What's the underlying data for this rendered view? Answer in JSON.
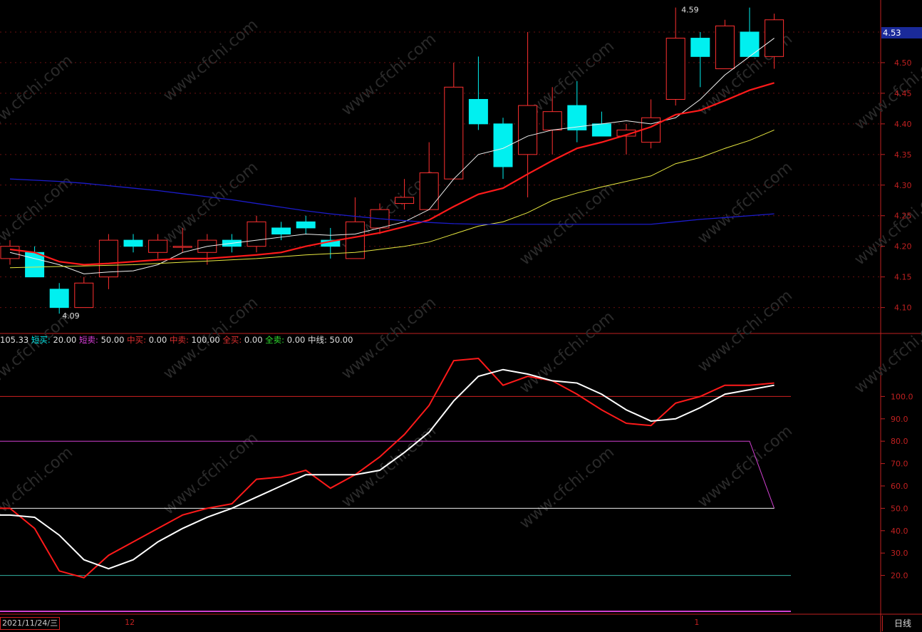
{
  "price_tag": "4.53",
  "period_button": "日线",
  "date_label": "2021/11/24/三",
  "x_labels": [
    {
      "text": "12",
      "index": 4.6
    },
    {
      "text": "1",
      "index": 27.7
    }
  ],
  "indicator_prefix": "105.33",
  "indicator_items": [
    {
      "label": "短买:",
      "value": "20.00",
      "color": "#00e5e5"
    },
    {
      "label": "短卖:",
      "value": "50.00",
      "color": "#e040e0"
    },
    {
      "label": "中买:",
      "value": "0.00",
      "color": "#e03030"
    },
    {
      "label": "中卖:",
      "value": "100.00",
      "color": "#e03030"
    },
    {
      "label": "全买:",
      "value": "0.00",
      "color": "#e03030"
    },
    {
      "label": "全卖:",
      "value": "0.00",
      "color": "#30e030"
    },
    {
      "label": "中线:",
      "value": "50.00",
      "color": "#e0e0e0"
    }
  ],
  "watermark": "www.cfchi.com",
  "chart_data": [
    {
      "type": "candlestick",
      "ylim": [
        4.06,
        4.6
      ],
      "y_ticks": [
        4.1,
        4.15,
        4.2,
        4.25,
        4.3,
        4.35,
        4.4,
        4.45,
        4.5,
        4.55
      ],
      "annotations": [
        {
          "text": "4.09",
          "index": 2
        },
        {
          "text": "4.59",
          "index": 27
        }
      ],
      "candles": [
        {
          "o": 4.18,
          "h": 4.21,
          "l": 4.17,
          "c": 4.2
        },
        {
          "o": 4.19,
          "h": 4.2,
          "l": 4.15,
          "c": 4.15
        },
        {
          "o": 4.13,
          "h": 4.14,
          "l": 4.09,
          "c": 4.1
        },
        {
          "o": 4.1,
          "h": 4.15,
          "l": 4.1,
          "c": 4.14
        },
        {
          "o": 4.15,
          "h": 4.22,
          "l": 4.13,
          "c": 4.21
        },
        {
          "o": 4.21,
          "h": 4.22,
          "l": 4.19,
          "c": 4.2
        },
        {
          "o": 4.19,
          "h": 4.22,
          "l": 4.18,
          "c": 4.21
        },
        {
          "o": 4.2,
          "h": 4.23,
          "l": 4.19,
          "c": 4.2
        },
        {
          "o": 4.19,
          "h": 4.22,
          "l": 4.17,
          "c": 4.21
        },
        {
          "o": 4.21,
          "h": 4.22,
          "l": 4.19,
          "c": 4.2
        },
        {
          "o": 4.2,
          "h": 4.25,
          "l": 4.19,
          "c": 4.24
        },
        {
          "o": 4.23,
          "h": 4.24,
          "l": 4.21,
          "c": 4.22
        },
        {
          "o": 4.24,
          "h": 4.25,
          "l": 4.22,
          "c": 4.23
        },
        {
          "o": 4.21,
          "h": 4.23,
          "l": 4.18,
          "c": 4.2
        },
        {
          "o": 4.18,
          "h": 4.28,
          "l": 4.18,
          "c": 4.24
        },
        {
          "o": 4.23,
          "h": 4.27,
          "l": 4.22,
          "c": 4.26
        },
        {
          "o": 4.27,
          "h": 4.31,
          "l": 4.26,
          "c": 4.28
        },
        {
          "o": 4.26,
          "h": 4.37,
          "l": 4.26,
          "c": 4.32
        },
        {
          "o": 4.31,
          "h": 4.5,
          "l": 4.31,
          "c": 4.46
        },
        {
          "o": 4.44,
          "h": 4.51,
          "l": 4.39,
          "c": 4.4
        },
        {
          "o": 4.4,
          "h": 4.41,
          "l": 4.31,
          "c": 4.33
        },
        {
          "o": 4.35,
          "h": 4.55,
          "l": 4.28,
          "c": 4.43
        },
        {
          "o": 4.39,
          "h": 4.46,
          "l": 4.35,
          "c": 4.42
        },
        {
          "o": 4.43,
          "h": 4.47,
          "l": 4.37,
          "c": 4.39
        },
        {
          "o": 4.4,
          "h": 4.42,
          "l": 4.38,
          "c": 4.38
        },
        {
          "o": 4.38,
          "h": 4.4,
          "l": 4.35,
          "c": 4.39
        },
        {
          "o": 4.37,
          "h": 4.44,
          "l": 4.36,
          "c": 4.41
        },
        {
          "o": 4.44,
          "h": 4.59,
          "l": 4.43,
          "c": 4.54
        },
        {
          "o": 4.54,
          "h": 4.55,
          "l": 4.46,
          "c": 4.51
        },
        {
          "o": 4.49,
          "h": 4.57,
          "l": 4.49,
          "c": 4.56
        },
        {
          "o": 4.55,
          "h": 4.59,
          "l": 4.51,
          "c": 4.51
        },
        {
          "o": 4.51,
          "h": 4.58,
          "l": 4.49,
          "c": 4.57
        }
      ],
      "series": [
        {
          "color": "#f0f0f0",
          "width": 1,
          "values": [
            4.19,
            4.18,
            4.17,
            4.155,
            4.158,
            4.16,
            4.17,
            4.19,
            4.2,
            4.205,
            4.21,
            4.215,
            4.22,
            4.218,
            4.22,
            4.23,
            4.24,
            4.26,
            4.31,
            4.35,
            4.36,
            4.38,
            4.39,
            4.395,
            4.4,
            4.405,
            4.4,
            4.41,
            4.44,
            4.48,
            4.51,
            4.54
          ]
        },
        {
          "color": "#ff1a1a",
          "width": 2.2,
          "values": [
            4.195,
            4.19,
            4.175,
            4.17,
            4.172,
            4.175,
            4.178,
            4.18,
            4.18,
            4.183,
            4.186,
            4.19,
            4.2,
            4.208,
            4.215,
            4.222,
            4.232,
            4.243,
            4.265,
            4.285,
            4.295,
            4.318,
            4.34,
            4.36,
            4.37,
            4.382,
            4.395,
            4.415,
            4.422,
            4.438,
            4.455,
            4.467
          ]
        },
        {
          "color": "#e8e840",
          "width": 1,
          "values": [
            4.165,
            4.166,
            4.167,
            4.168,
            4.169,
            4.17,
            4.172,
            4.174,
            4.176,
            4.178,
            4.18,
            4.183,
            4.186,
            4.188,
            4.19,
            4.195,
            4.2,
            4.207,
            4.22,
            4.233,
            4.24,
            4.255,
            4.275,
            4.287,
            4.297,
            4.306,
            4.315,
            4.335,
            4.345,
            4.36,
            4.373,
            4.39
          ]
        },
        {
          "color": "#1c1ccc",
          "width": 1.3,
          "values": [
            4.31,
            4.308,
            4.306,
            4.303,
            4.299,
            4.295,
            4.291,
            4.286,
            4.281,
            4.276,
            4.27,
            4.264,
            4.258,
            4.253,
            4.249,
            4.245,
            4.242,
            4.239,
            4.237,
            4.236,
            4.236,
            4.236,
            4.236,
            4.236,
            4.236,
            4.236,
            4.236,
            4.24,
            4.244,
            4.247,
            4.25,
            4.253
          ]
        }
      ]
    },
    {
      "type": "line",
      "ylim": [
        0,
        120
      ],
      "y_ticks": [
        20,
        30,
        40,
        50,
        60,
        70,
        80,
        90,
        100
      ],
      "series": [
        {
          "color": "#ff1a1a",
          "width": 2,
          "values": [
            50,
            41,
            22,
            19,
            29,
            35,
            41,
            47,
            50,
            52,
            63,
            64,
            67,
            59,
            65,
            73,
            83,
            96,
            116,
            117,
            105,
            109,
            107,
            101,
            94,
            88,
            87,
            97,
            100,
            105,
            105,
            106
          ]
        },
        {
          "color": "#ffffff",
          "width": 2,
          "values": [
            47,
            46,
            38,
            27,
            23,
            27,
            35,
            41,
            46,
            50,
            55,
            60,
            65,
            65,
            65,
            67,
            75,
            84,
            98,
            109,
            112,
            110,
            107,
            106,
            101,
            94,
            89,
            90,
            95,
            101,
            103,
            105
          ]
        }
      ],
      "hlines": [
        {
          "y": 100,
          "color": "#d02020"
        },
        {
          "y": 20,
          "color": "#30b0a0"
        }
      ],
      "stepped": [
        {
          "color": "#d040d0",
          "points": [
            [
              0,
              80
            ],
            [
              30,
              80
            ],
            [
              31,
              50
            ]
          ]
        },
        {
          "color": "#f0f0f0",
          "points": [
            [
              0,
              50
            ],
            [
              31,
              50
            ]
          ]
        }
      ]
    }
  ]
}
